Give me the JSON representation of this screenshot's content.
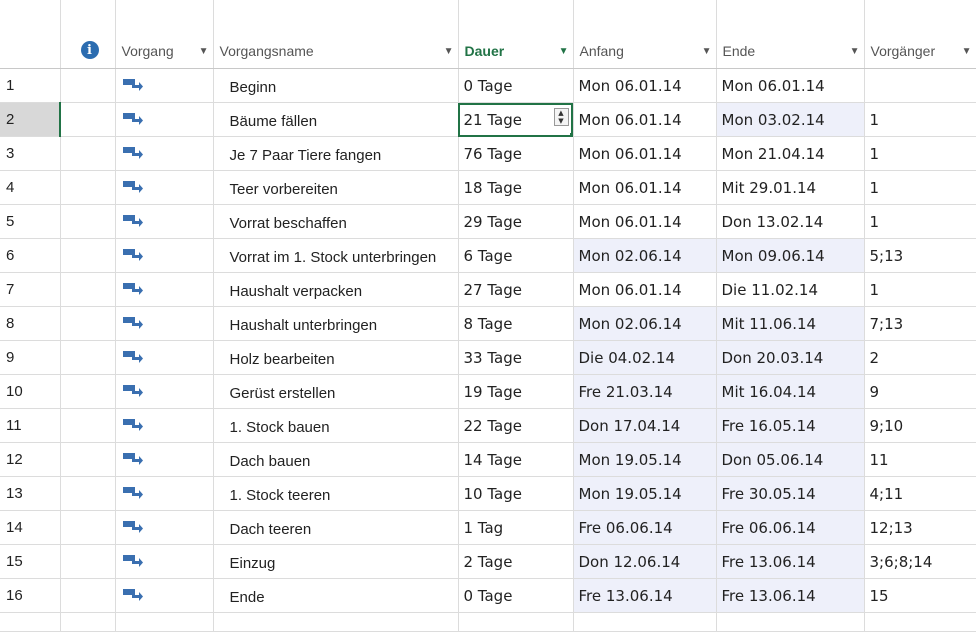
{
  "columns": {
    "mode": "Vorgang",
    "name": "Vorgangsname",
    "duration": "Dauer",
    "start": "Anfang",
    "end": "Ende",
    "predecessors": "Vorgänger"
  },
  "info_icon": "info-icon",
  "task_icon": "auto-scheduled-task-icon",
  "colors": {
    "accent": "#217346",
    "icon": "#2b6cb0",
    "shade": "#eef0fa"
  },
  "rows": [
    {
      "id": "1",
      "name": "Beginn",
      "duration": "0 Tage",
      "start": "Mon 06.01.14",
      "end": "Mon 06.01.14",
      "pred": ""
    },
    {
      "id": "2",
      "name": "Bäume fällen",
      "duration": "21 Tage",
      "start": "Mon 06.01.14",
      "end": "Mon 03.02.14",
      "pred": "1"
    },
    {
      "id": "3",
      "name": "Je 7 Paar Tiere fangen",
      "duration": "76 Tage",
      "start": "Mon 06.01.14",
      "end": "Mon 21.04.14",
      "pred": "1"
    },
    {
      "id": "4",
      "name": "Teer vorbereiten",
      "duration": "18 Tage",
      "start": "Mon 06.01.14",
      "end": "Mit 29.01.14",
      "pred": "1"
    },
    {
      "id": "5",
      "name": "Vorrat beschaffen",
      "duration": "29 Tage",
      "start": "Mon 06.01.14",
      "end": "Don 13.02.14",
      "pred": "1"
    },
    {
      "id": "6",
      "name": "Vorrat im 1. Stock unterbringen",
      "duration": "6 Tage",
      "start": "Mon 02.06.14",
      "end": "Mon 09.06.14",
      "pred": "5;13"
    },
    {
      "id": "7",
      "name": "Haushalt verpacken",
      "duration": "27 Tage",
      "start": "Mon 06.01.14",
      "end": "Die 11.02.14",
      "pred": "1"
    },
    {
      "id": "8",
      "name": "Haushalt unterbringen",
      "duration": "8 Tage",
      "start": "Mon 02.06.14",
      "end": "Mit 11.06.14",
      "pred": "7;13"
    },
    {
      "id": "9",
      "name": "Holz bearbeiten",
      "duration": "33 Tage",
      "start": "Die 04.02.14",
      "end": "Don 20.03.14",
      "pred": "2"
    },
    {
      "id": "10",
      "name": "Gerüst erstellen",
      "duration": "19 Tage",
      "start": "Fre 21.03.14",
      "end": "Mit 16.04.14",
      "pred": "9"
    },
    {
      "id": "11",
      "name": "1. Stock bauen",
      "duration": "22 Tage",
      "start": "Don 17.04.14",
      "end": "Fre 16.05.14",
      "pred": "9;10"
    },
    {
      "id": "12",
      "name": "Dach bauen",
      "duration": "14 Tage",
      "start": "Mon 19.05.14",
      "end": "Don 05.06.14",
      "pred": "11"
    },
    {
      "id": "13",
      "name": "1. Stock teeren",
      "duration": "10 Tage",
      "start": "Mon 19.05.14",
      "end": "Fre 30.05.14",
      "pred": "4;11"
    },
    {
      "id": "14",
      "name": "Dach teeren",
      "duration": "1 Tag",
      "start": "Fre 06.06.14",
      "end": "Fre 06.06.14",
      "pred": "12;13"
    },
    {
      "id": "15",
      "name": "Einzug",
      "duration": "2 Tage",
      "start": "Don 12.06.14",
      "end": "Fre 13.06.14",
      "pred": "3;6;8;14"
    },
    {
      "id": "16",
      "name": "Ende",
      "duration": "0 Tage",
      "start": "Fre 13.06.14",
      "end": "Fre 13.06.14",
      "pred": "15"
    }
  ]
}
